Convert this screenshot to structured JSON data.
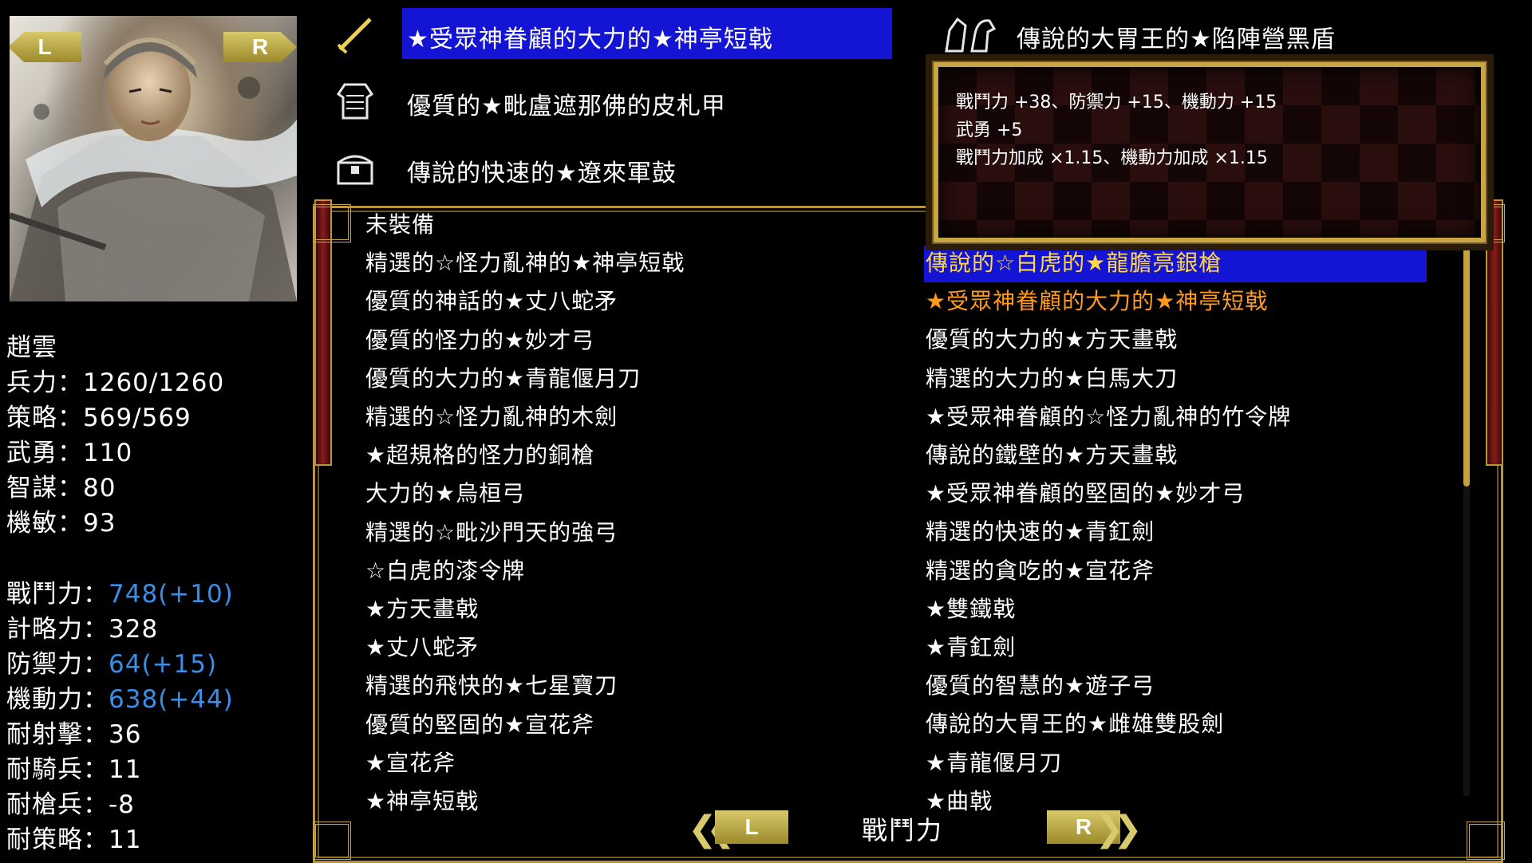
{
  "portrait": {
    "alt": "趙雲 portrait",
    "left_button": "L",
    "right_button": "R"
  },
  "hero": {
    "name": "趙雲",
    "stats": [
      {
        "label": "兵力",
        "value": "1260/1260",
        "boosted": false
      },
      {
        "label": "策略",
        "value": "569/569",
        "boosted": false
      },
      {
        "label": "武勇",
        "value": "110",
        "boosted": false
      },
      {
        "label": "智謀",
        "value": "80",
        "boosted": false
      },
      {
        "label": "機敏",
        "value": "93",
        "boosted": false
      }
    ],
    "combat": [
      {
        "label": "戰鬥力",
        "value": "748(+10)",
        "boosted": true
      },
      {
        "label": "計略力",
        "value": "328",
        "boosted": false
      },
      {
        "label": "防禦力",
        "value": "64(+15)",
        "boosted": true
      },
      {
        "label": "機動力",
        "value": "638(+44)",
        "boosted": true
      },
      {
        "label": "耐射擊",
        "value": "36",
        "boosted": false
      },
      {
        "label": "耐騎兵",
        "value": "11",
        "boosted": false
      },
      {
        "label": "耐槍兵",
        "value": "-8",
        "boosted": false
      },
      {
        "label": "耐策略",
        "value": "11",
        "boosted": false
      }
    ],
    "separator": "："
  },
  "equipment": [
    {
      "icon": "sword-icon",
      "name": "★受眾神眷顧的大力的★神亭短戟",
      "selected": true
    },
    {
      "icon": "armor-icon",
      "name": "優質的★毗盧遮那佛的皮札甲",
      "selected": false
    },
    {
      "icon": "treasure-chest-icon",
      "name": "傳說的快速的★遼來軍鼓",
      "selected": false
    },
    {
      "icon": "horse-icon",
      "name": "傳說的大胃王的★陷陣營黑盾",
      "selected": false
    }
  ],
  "tooltip": {
    "lines": [
      "戰鬥力 +38、防禦力 +15、機動力 +15",
      "武勇 +5",
      "戰鬥力加成 ×1.15、機動力加成 ×1.15"
    ]
  },
  "item_list": {
    "left_column": [
      "未裝備",
      "精選的☆怪力亂神的★神亭短戟",
      "優質的神話的★丈八蛇矛",
      "優質的怪力的★妙才弓",
      "優質的大力的★青龍偃月刀",
      "精選的☆怪力亂神的木劍",
      "★超規格的怪力的銅槍",
      "大力的★烏桓弓",
      "精選的☆毗沙門天的強弓",
      "☆白虎的漆令牌",
      "★方天畫戟",
      "★丈八蛇矛",
      "精選的飛快的★七星寶刀",
      "優質的堅固的★宣花斧",
      "★宣花斧",
      "★神亭短戟"
    ],
    "right_column": [
      "傳說的☆白虎的★龍膽亮銀槍",
      "★受眾神眷顧的大力的★神亭短戟",
      "優質的大力的★方天畫戟",
      "精選的大力的★白馬大刀",
      "★受眾神眷顧的☆怪力亂神的竹令牌",
      "傳說的鐵壁的★方天畫戟",
      "★受眾神眷顧的堅固的★妙才弓",
      "精選的快速的★青釭劍",
      "精選的貪吃的★宣花斧",
      "★雙鐵戟",
      "★青釭劍",
      "優質的智慧的★遊子弓",
      "傳說的大胃王的★雌雄雙股劍",
      "★青龍偃月刀",
      "★曲戟"
    ],
    "highlighted_item": "傳說的☆白虎的★龍膽亮銀槍",
    "equipped_item": "★受眾神眷顧的大力的★神亭短戟"
  },
  "sort_bar": {
    "left_button": "L",
    "label": "戰鬥力",
    "right_button": "R"
  },
  "colors": {
    "selection_blue": "#1414d4",
    "boost_blue": "#3b8ee8",
    "highlight_gold": "#ffd64a",
    "equipped_orange": "#ff9a1f",
    "frame_gold": "#b8953a"
  }
}
